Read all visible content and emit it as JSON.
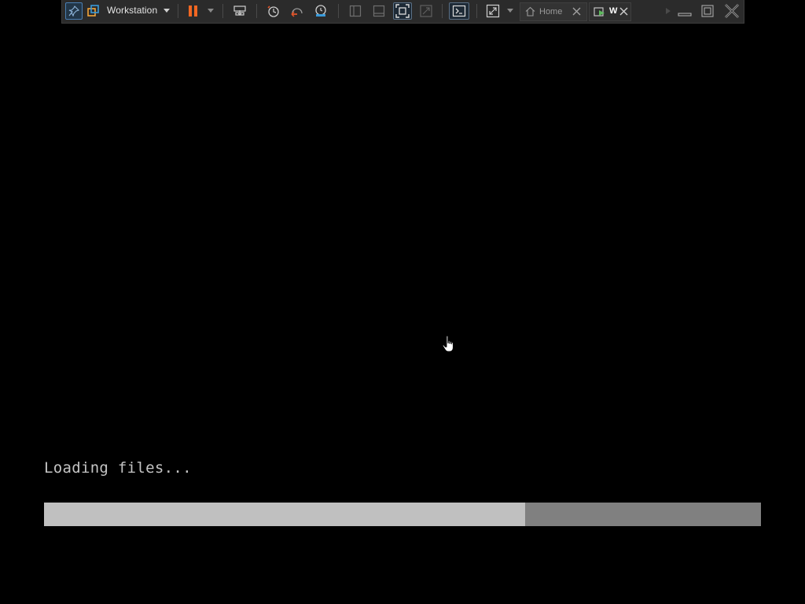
{
  "toolbar": {
    "product_label": "Workstation",
    "tabs": [
      {
        "label": "Home",
        "icon": "home-icon"
      },
      {
        "label": "W",
        "icon": "vm-running-icon"
      }
    ],
    "pause_color": "#f26722",
    "accent_color": "#4a7fb5"
  },
  "boot": {
    "status_text": "Loading files...",
    "progress": 0.671,
    "progress_fill_color": "#c0c0c0",
    "progress_track_color": "#808080"
  }
}
